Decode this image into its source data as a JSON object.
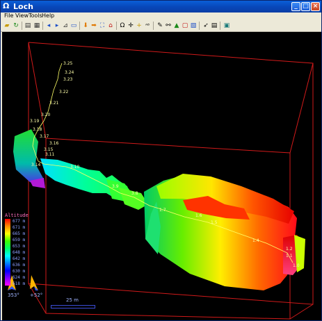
{
  "window": {
    "title": "Loch",
    "app_icon": "Ω"
  },
  "menu": [
    "File",
    "View",
    "Tools",
    "Help"
  ],
  "toolbar_icons": [
    "open-icon",
    "refresh-icon",
    "print-icon",
    "print-preview-icon",
    "back-icon",
    "forward-icon",
    "ruler-icon",
    "screen-icon",
    "arrow-down-icon",
    "arrow-right-icon",
    "fit-icon",
    "home-icon",
    "omega-icon",
    "crosshair-icon",
    "plus-icon",
    "text-icon",
    "pencil-icon",
    "link-icon",
    "terrain-icon",
    "box-icon",
    "layers-icon",
    "pointer-icon",
    "document-icon",
    "monitor-icon"
  ],
  "stations": [
    {
      "id": "3.25",
      "label": "3.25"
    },
    {
      "id": "3.24",
      "label": "3.24"
    },
    {
      "id": "3.23",
      "label": "3.23"
    },
    {
      "id": "3.22",
      "label": "3.22"
    },
    {
      "id": "3.21",
      "label": "3.21"
    },
    {
      "id": "3.20",
      "label": "3.20"
    },
    {
      "id": "3.19",
      "label": "3.19"
    },
    {
      "id": "3.18",
      "label": "3.18"
    },
    {
      "id": "3.17",
      "label": "3.17"
    },
    {
      "id": "3.16",
      "label": "3.16"
    },
    {
      "id": "3.15",
      "label": "3.15"
    },
    {
      "id": "3.14",
      "label": "3.14"
    },
    {
      "id": "3.11",
      "label": "3.11"
    },
    {
      "id": "3.10",
      "label": "3.10"
    },
    {
      "id": "3.9",
      "label": "3.9"
    },
    {
      "id": "3.8",
      "label": "3.8"
    },
    {
      "id": "1.7",
      "label": "1.7"
    },
    {
      "id": "1.6",
      "label": "1.6"
    },
    {
      "id": "1.5",
      "label": "1.5"
    },
    {
      "id": "1.4",
      "label": "1.4"
    },
    {
      "id": "1.2",
      "label": "1.2"
    },
    {
      "id": "1.1",
      "label": "1.1"
    },
    {
      "id": "1.0",
      "label": "1.0"
    }
  ],
  "legend": {
    "title": "Altitude",
    "labels": [
      "677 m",
      "671 m",
      "665 m",
      "659 m",
      "653 m",
      "648 m",
      "642 m",
      "636 m",
      "630 m",
      "624 m",
      "618 m"
    ]
  },
  "hud": {
    "heading": "353°",
    "tilt": "+52°",
    "scale_label": "25 m"
  },
  "colors": {
    "bbox": "#d11a1a",
    "survey": "#ffff66",
    "legend_text": "#8fa0ff",
    "legend_title": "#ff6fbf"
  }
}
